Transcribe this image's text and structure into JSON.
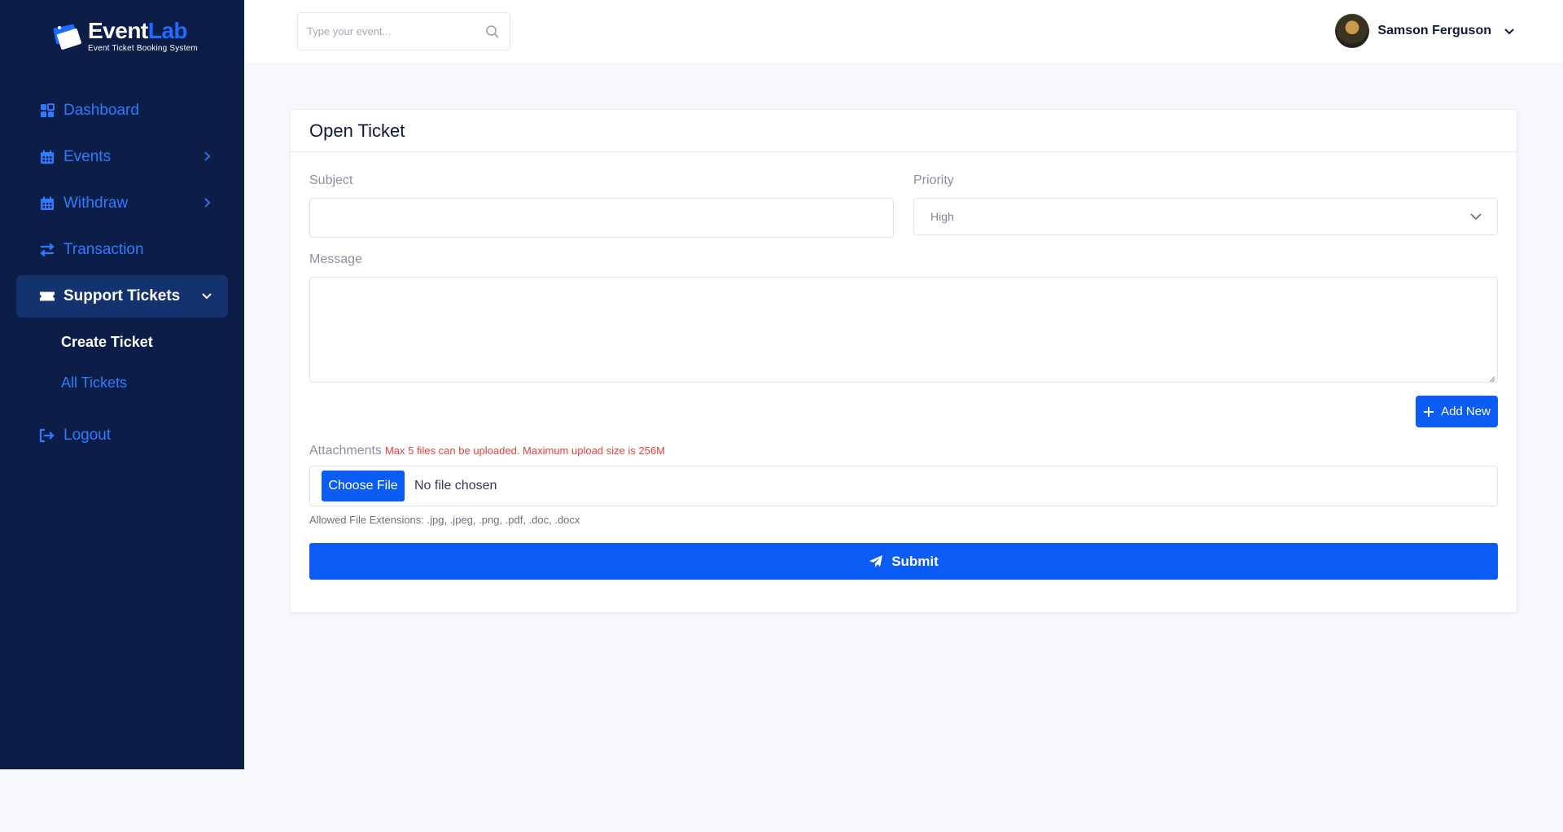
{
  "brand": {
    "name_part1": "Event",
    "name_part2": "Lab",
    "tagline": "Event Ticket Booking System",
    "logo_icon": "ticket-logo-icon"
  },
  "sidebar": {
    "items": [
      {
        "label": "Dashboard",
        "icon": "dashboard-grid-icon"
      },
      {
        "label": "Events",
        "icon": "calendar-icon"
      },
      {
        "label": "Withdraw",
        "icon": "calendar-icon"
      },
      {
        "label": "Transaction",
        "icon": "exchange-arrows-icon"
      },
      {
        "label": "Support Tickets",
        "icon": "ticket-icon"
      },
      {
        "label": "Logout",
        "icon": "logout-icon"
      }
    ],
    "subitems": [
      {
        "label": "Create Ticket"
      },
      {
        "label": "All Tickets"
      }
    ]
  },
  "header": {
    "search_placeholder": "Type your event...",
    "user_name": "Samson Ferguson"
  },
  "form": {
    "title": "Open Ticket",
    "subject_label": "Subject",
    "subject_value": "",
    "priority_label": "Priority",
    "priority_value": "High",
    "message_label": "Message",
    "message_value": "",
    "add_new_label": "Add New",
    "attachments_label": "Attachments",
    "attachments_note": "Max 5 files can be uploaded. Maximum upload size is 256M",
    "choose_file_label": "Choose File",
    "no_file_text": "No file chosen",
    "allowed_extensions": "Allowed File Extensions: .jpg, .jpeg, .png, .pdf, .doc, .docx",
    "submit_label": "Submit"
  },
  "colors": {
    "sidebar_bg": "#0c1e47",
    "accent": "#0b5cf5",
    "link_blue": "#2d7cff",
    "error_red": "#e4423b"
  }
}
